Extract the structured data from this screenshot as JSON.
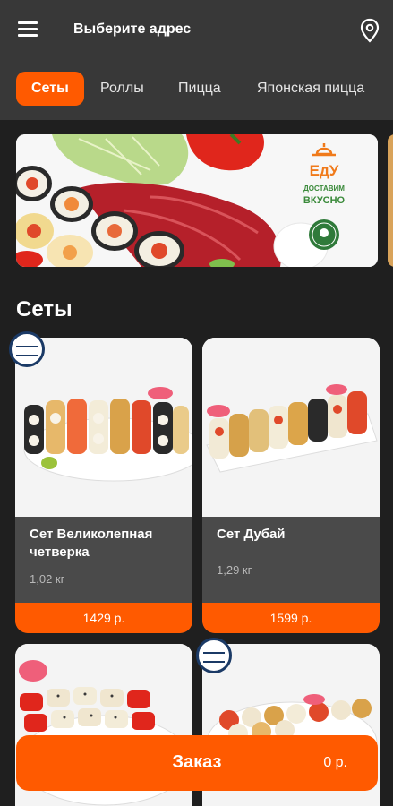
{
  "header": {
    "address_prompt": "Выберите адрес",
    "menu_icon": "hamburger-icon",
    "location_icon": "map-pin-icon"
  },
  "tabs": [
    {
      "label": "Сеты",
      "active": true
    },
    {
      "label": "Роллы",
      "active": false
    },
    {
      "label": "Пицца",
      "active": false
    },
    {
      "label": "Японская пицца",
      "active": false
    }
  ],
  "banner": {
    "brand": "ЕдУ",
    "tagline_1": "ДОСТАВИМ",
    "tagline_2": "ВКУСНО"
  },
  "section": {
    "title": "Сеты"
  },
  "products": [
    {
      "name": "Сет Великолепная четверка",
      "weight": "1,02 кг",
      "price": "1429 р."
    },
    {
      "name": "Сет Дубай",
      "weight": "1,29 кг",
      "price": "1599 р."
    }
  ],
  "order": {
    "label": "Заказ",
    "sum": "0 р."
  },
  "colors": {
    "accent": "#ff5a00",
    "background": "#1f1f1f",
    "header": "#383838",
    "card": "#4a4a4a"
  }
}
